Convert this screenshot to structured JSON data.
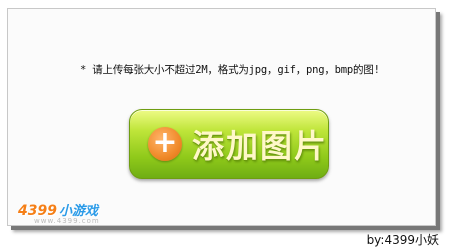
{
  "hint_text": "* 请上传每张大小不超过2M，格式为jpg，gif，png，bmp的图!",
  "add_button": {
    "label": "添加图片",
    "icon": "plus-icon"
  },
  "watermark": {
    "logo_number": "4399",
    "logo_text": "小游戏",
    "url": "www.4399.com"
  },
  "credit": "by:4399小妖",
  "colors": {
    "button_green": "#8fc91a",
    "plus_orange": "#f08a2a",
    "label_cream": "#fff8c8"
  }
}
